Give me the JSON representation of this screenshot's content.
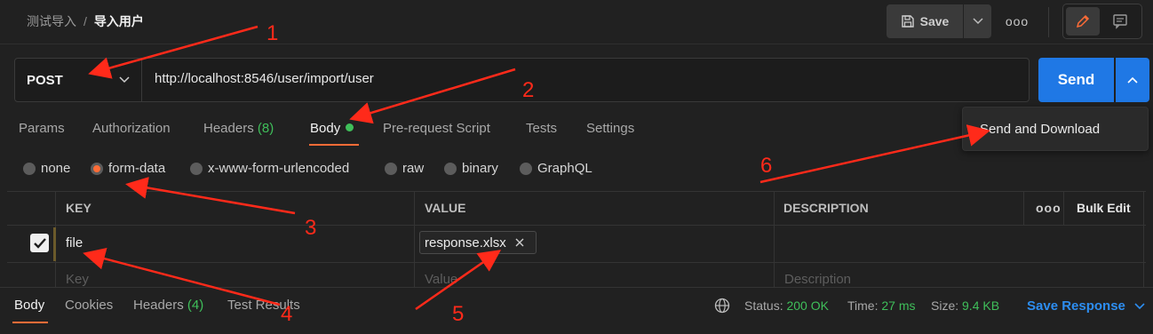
{
  "header": {
    "breadcrumb_parent": "测试导入",
    "breadcrumb_sep": "/",
    "breadcrumb_current": "导入用户",
    "save_label": "Save",
    "more_label": "ooo"
  },
  "request": {
    "method": "POST",
    "url": "http://localhost:8546/user/import/user",
    "send_label": "Send"
  },
  "send_menu": {
    "item": "Send and Download"
  },
  "tabs": {
    "params": "Params",
    "authorization": "Authorization",
    "headers_label": "Headers",
    "headers_count": "(8)",
    "body": "Body",
    "prerequest": "Pre-request Script",
    "tests": "Tests",
    "settings": "Settings"
  },
  "body_types": {
    "none": "none",
    "form_data": "form-data",
    "urlencoded": "x-www-form-urlencoded",
    "raw": "raw",
    "binary": "binary",
    "graphql": "GraphQL",
    "selected": "form-data"
  },
  "table": {
    "headers": {
      "key": "KEY",
      "value": "VALUE",
      "description": "DESCRIPTION",
      "more": "ooo",
      "bulk_edit": "Bulk Edit"
    },
    "rows": [
      {
        "checked": true,
        "key": "file",
        "value_file": "response.xlsx"
      }
    ],
    "placeholders": {
      "key": "Key",
      "value": "Value",
      "description": "Description"
    }
  },
  "response": {
    "tabs": {
      "body": "Body",
      "cookies": "Cookies",
      "headers_label": "Headers",
      "headers_count": "(4)",
      "test_results": "Test Results"
    },
    "status_label": "Status:",
    "status_value": "200 OK",
    "time_label": "Time:",
    "time_value": "27 ms",
    "size_label": "Size:",
    "size_value": "9.4 KB",
    "save_label": "Save Response"
  },
  "annotations": [
    "1",
    "2",
    "3",
    "4",
    "5",
    "6"
  ],
  "colors": {
    "accent": "#ff6c37",
    "send_blue": "#1f78e5",
    "success": "#3fbf5a",
    "annotation": "#ff2a1a"
  }
}
